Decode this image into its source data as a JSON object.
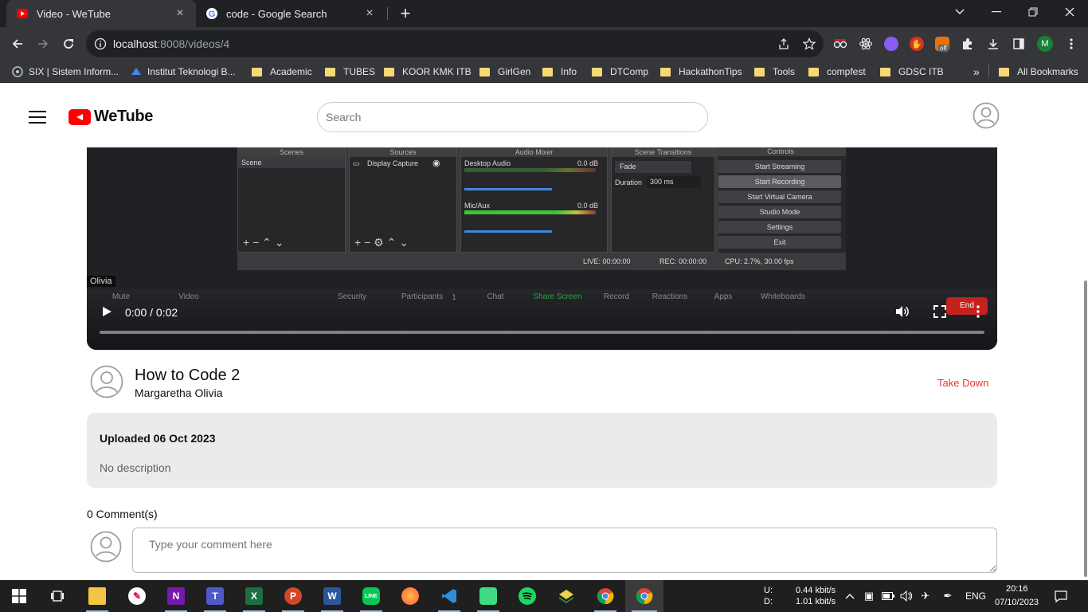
{
  "browser": {
    "tabs": [
      {
        "title": "Video - WeTube",
        "active": true,
        "favicon": "wetube-favicon-icon"
      },
      {
        "title": "code - Google Search",
        "active": false,
        "favicon": "google-favicon-icon"
      }
    ],
    "url_host": "localhost",
    "url_rest": ":8008/videos/4",
    "profile_initial": "M",
    "extensions_badge": "off",
    "bookmarks": [
      {
        "label": "SIX | Sistem Inform...",
        "type": "site"
      },
      {
        "label": "Institut Teknologi B...",
        "type": "site"
      },
      {
        "label": "Academic",
        "type": "folder"
      },
      {
        "label": "TUBES",
        "type": "folder"
      },
      {
        "label": "KOOR KMK ITB",
        "type": "folder"
      },
      {
        "label": "GirlGen",
        "type": "folder"
      },
      {
        "label": "Info",
        "type": "folder"
      },
      {
        "label": "DTComp",
        "type": "folder"
      },
      {
        "label": "HackathonTips",
        "type": "folder"
      },
      {
        "label": "Tools",
        "type": "folder"
      },
      {
        "label": "compfest",
        "type": "folder"
      },
      {
        "label": "GDSC ITB",
        "type": "folder"
      }
    ],
    "bookmarks_overflow": "»",
    "all_bookmarks": "All Bookmarks"
  },
  "app": {
    "logo": "WeTube",
    "search_placeholder": "Search",
    "brand_color": "#ff0000"
  },
  "video": {
    "time": "0:00 / 0:02",
    "progress": 0.0,
    "frame": {
      "panels": [
        "Scenes",
        "Sources",
        "Audio Mixer",
        "Scene Transitions",
        "Controls"
      ],
      "scene": "Scene",
      "source": "Display Capture",
      "desktop_audio": "Desktop Audio",
      "mic_aux": "Mic/Aux",
      "db1": "0.0 dB",
      "db2": "0.0 dB",
      "transition": "Fade",
      "duration_label": "Duration",
      "duration_value": "300 ms",
      "controls": [
        "Start Streaming",
        "Start Recording",
        "Start Virtual Camera",
        "Studio Mode",
        "Settings",
        "Exit"
      ],
      "status_live": "LIVE: 00:00:00",
      "status_rec": "REC: 00:00:00",
      "status_cpu": "CPU: 2.7%, 30.00 fps",
      "participant": "Olivia",
      "meeting_items": [
        "Mute",
        "Video",
        "Security",
        "Participants",
        "Chat",
        "Share Screen",
        "Record",
        "Reactions",
        "Apps",
        "Whiteboards"
      ],
      "participants_count": "1",
      "end": "End"
    }
  },
  "info": {
    "title": "How to Code 2",
    "channel": "Margaretha Olivia",
    "take_down": "Take Down",
    "uploaded": "Uploaded 06 Oct 2023",
    "description": "No description",
    "comments_count": "0 Comment(s)",
    "comment_placeholder": "Type your comment here"
  },
  "taskbar": {
    "apps": [
      "start",
      "task-view",
      "file-explorer",
      "paint",
      "onenote",
      "teams",
      "excel",
      "powerpoint",
      "word",
      "line",
      "firefox",
      "vscode",
      "android-studio",
      "spotify",
      "3d-app",
      "chrome",
      "chrome-active"
    ],
    "net_u_label": "U:",
    "net_d_label": "D:",
    "net_up": "0.44 kbit/s",
    "net_down": "1.01 kbit/s",
    "lang": "ENG",
    "time": "20:16",
    "date": "07/10/2023"
  }
}
